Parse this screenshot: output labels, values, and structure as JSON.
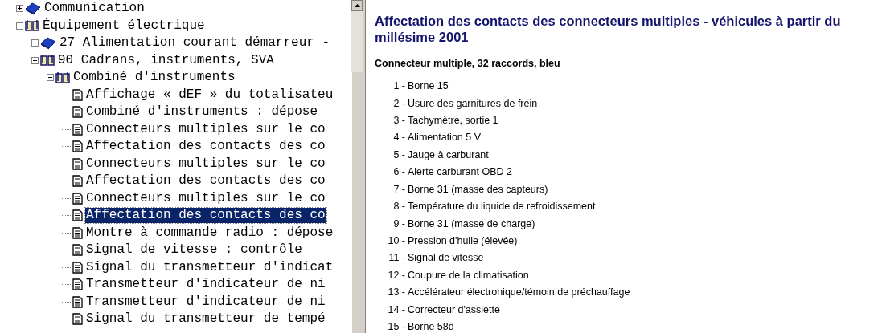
{
  "tree": [
    {
      "kind": "folder",
      "label": "Communication",
      "expanded": false,
      "selected": false
    },
    {
      "kind": "folder",
      "label": "Équipement électrique",
      "expanded": true,
      "selected": false,
      "children": [
        {
          "kind": "folder",
          "label": "27 Alimentation courant démarreur -",
          "expanded": false,
          "selected": false
        },
        {
          "kind": "folder",
          "label": "90 Cadrans, instruments, SVA",
          "expanded": true,
          "selected": false,
          "children": [
            {
              "kind": "folder",
              "label": "Combiné d'instruments",
              "expanded": true,
              "selected": false,
              "children": [
                {
                  "kind": "document",
                  "label": "Affichage « dEF » du totalisateu",
                  "selected": false
                },
                {
                  "kind": "document",
                  "label": "Combiné d'instruments : dépose",
                  "selected": false
                },
                {
                  "kind": "document",
                  "label": "Connecteurs multiples sur le co",
                  "selected": false
                },
                {
                  "kind": "document",
                  "label": "Affectation des contacts des co",
                  "selected": false
                },
                {
                  "kind": "document",
                  "label": "Connecteurs multiples sur le co",
                  "selected": false
                },
                {
                  "kind": "document",
                  "label": "Affectation des contacts des co",
                  "selected": false
                },
                {
                  "kind": "document",
                  "label": "Connecteurs multiples sur le co",
                  "selected": false
                },
                {
                  "kind": "document",
                  "label": "Affectation des contacts des co",
                  "selected": true
                },
                {
                  "kind": "document",
                  "label": "Montre à commande radio : dépose",
                  "selected": false
                },
                {
                  "kind": "document",
                  "label": "Signal de vitesse : contrôle",
                  "selected": false
                },
                {
                  "kind": "document",
                  "label": "Signal du transmetteur d'indicat",
                  "selected": false
                },
                {
                  "kind": "document",
                  "label": "Transmetteur d'indicateur de ni",
                  "selected": false
                },
                {
                  "kind": "document",
                  "label": "Transmetteur d'indicateur de ni",
                  "selected": false
                },
                {
                  "kind": "document",
                  "label": "Signal du transmetteur de tempé",
                  "selected": false
                }
              ]
            }
          ]
        }
      ]
    }
  ],
  "document": {
    "title": "Affectation des contacts des connecteurs multiples - véhicules à partir du millésime 2001",
    "subtitle": "Connecteur multiple, 32 raccords, bleu",
    "pins": [
      {
        "number": "1 -",
        "text": "Borne 15"
      },
      {
        "number": "2 -",
        "text": "Usure des garnitures de frein"
      },
      {
        "number": "3 -",
        "text": "Tachymètre, sortie 1"
      },
      {
        "number": "4 -",
        "text": "Alimentation 5 V"
      },
      {
        "number": "5 -",
        "text": "Jauge à carburant"
      },
      {
        "number": "6 -",
        "text": "Alerte carburant OBD 2"
      },
      {
        "number": "7 -",
        "text": "Borne 31 (masse des capteurs)"
      },
      {
        "number": "8 -",
        "text": "Température du liquide de refroidissement"
      },
      {
        "number": "9 -",
        "text": "Borne 31 (masse de charge)"
      },
      {
        "number": "10 -",
        "text": "Pression d'huile (élevée)"
      },
      {
        "number": "11 -",
        "text": "Signal de vitesse"
      },
      {
        "number": "12 -",
        "text": "Coupure de la climatisation"
      },
      {
        "number": "13 -",
        "text": "Accélérateur électronique/témoin de préchauffage"
      },
      {
        "number": "14 -",
        "text": "Correcteur d'assiette"
      },
      {
        "number": "15 -",
        "text": "Borne 58d"
      }
    ]
  }
}
